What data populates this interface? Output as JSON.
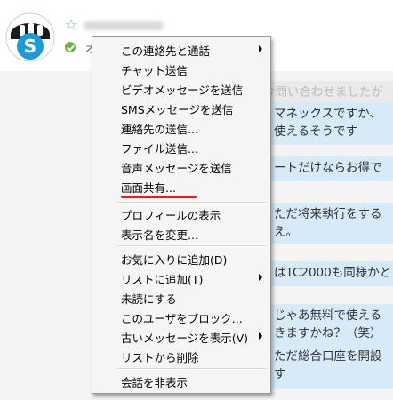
{
  "header": {
    "status_text": "オ"
  },
  "menu": {
    "items": [
      {
        "label": "この連絡先と通話",
        "submenu": true
      },
      {
        "label": "チャット送信"
      },
      {
        "label": "ビデオメッセージを送信"
      },
      {
        "label": "SMSメッセージを送信"
      },
      {
        "label": "連絡先の送信..."
      },
      {
        "label": "ファイル送信..."
      },
      {
        "label": "音声メッセージを送信"
      },
      {
        "label": "画面共有..."
      },
      {
        "label": "プロフィールの表示"
      },
      {
        "label": "表示名を変更..."
      },
      {
        "label": "お気に入りに追加(D)"
      },
      {
        "label": "リストに追加(T)",
        "submenu": true
      },
      {
        "label": "未読にする"
      },
      {
        "label": "このユーザをブロック..."
      },
      {
        "label": "古いメッセージを表示(V)",
        "submenu": true
      },
      {
        "label": "リストから削除"
      },
      {
        "label": "会話を非表示"
      }
    ]
  },
  "chat": {
    "bubbles": [
      "今問い合わせましたが",
      "マネックスですか、",
      "使えるそうです",
      "ートだけならお得で",
      "ただ将来執行をする",
      "え。",
      "はTC2000も同様かと",
      "じゃあ無料で使える",
      "きますかね？（笑）",
      "ただ総合口座を開設",
      "す"
    ]
  },
  "colors": {
    "bubble": "#d6ebf7",
    "menu_bg": "#f5f5f5",
    "highlight_underline": "#dd2222",
    "status_online": "#6db33f"
  }
}
